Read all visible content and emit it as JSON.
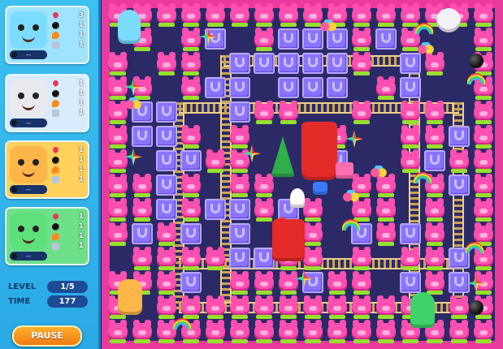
{
  "players": [
    {
      "id": "blue",
      "color": "#7cdcff",
      "card_bg": "#9fe4ff",
      "name_tag": "--",
      "stats": {
        "lives": "3",
        "bombs": "1",
        "power": "1",
        "speed": "1"
      }
    },
    {
      "id": "white",
      "color": "#e9e9f0",
      "card_bg": "#d9ecff",
      "name_tag": "--",
      "stats": {
        "lives": "1",
        "bombs": "1",
        "power": "1",
        "speed": "1"
      }
    },
    {
      "id": "orange",
      "color": "#ffb648",
      "card_bg": "#ffd15a",
      "name_tag": "--",
      "stats": {
        "lives": "1",
        "bombs": "1",
        "power": "1",
        "speed": "1"
      }
    },
    {
      "id": "green",
      "color": "#5ee07a",
      "card_bg": "#6fe08a",
      "name_tag": "--",
      "stats": {
        "lives": "1",
        "bombs": "1",
        "power": "1",
        "speed": "1"
      }
    }
  ],
  "hud": {
    "level_label": "LEVEL",
    "level_value": "1/5",
    "time_label": "TIME",
    "time_value": "177"
  },
  "pause_label": "PAUSE",
  "colors": {
    "panel": "#2aa9e6",
    "board": "#2b2a66",
    "frame": "#e93aa0",
    "pig": "#ff4fb0",
    "crate": "#8a73ff",
    "rail": "#c9a558",
    "pause": "#f07a12"
  }
}
